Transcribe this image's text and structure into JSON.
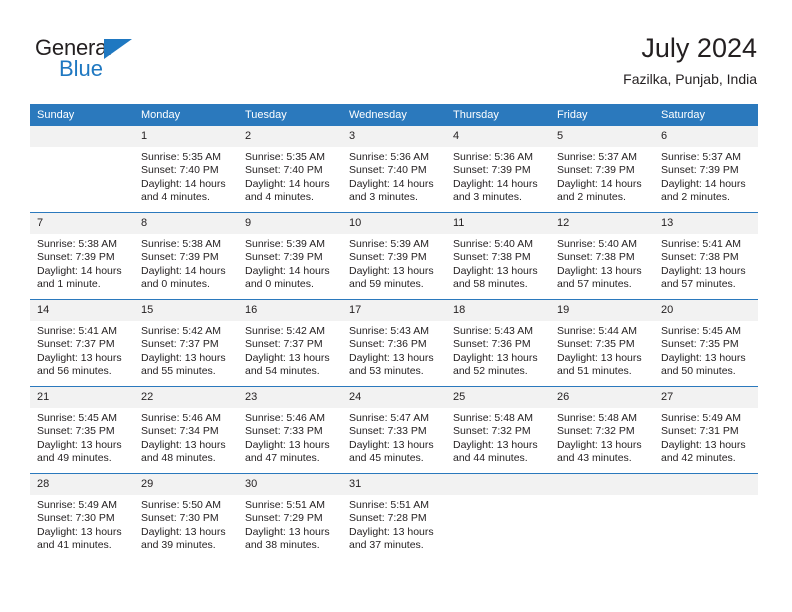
{
  "brand": {
    "name_top": "General",
    "name_bottom": "Blue"
  },
  "header": {
    "title": "July 2024",
    "subtitle": "Fazilka, Punjab, India"
  },
  "colors": {
    "header_blue": "#2b79bd",
    "logo_blue": "#1f78c1",
    "daynum_bg": "#f2f2f2",
    "text": "#231f20"
  },
  "weekdays": [
    "Sunday",
    "Monday",
    "Tuesday",
    "Wednesday",
    "Thursday",
    "Friday",
    "Saturday"
  ],
  "weeks": [
    [
      {
        "day": "",
        "sunrise": "",
        "sunset": "",
        "daylight": "",
        "daylight2": ""
      },
      {
        "day": "1",
        "sunrise": "Sunrise: 5:35 AM",
        "sunset": "Sunset: 7:40 PM",
        "daylight": "Daylight: 14 hours",
        "daylight2": "and 4 minutes."
      },
      {
        "day": "2",
        "sunrise": "Sunrise: 5:35 AM",
        "sunset": "Sunset: 7:40 PM",
        "daylight": "Daylight: 14 hours",
        "daylight2": "and 4 minutes."
      },
      {
        "day": "3",
        "sunrise": "Sunrise: 5:36 AM",
        "sunset": "Sunset: 7:40 PM",
        "daylight": "Daylight: 14 hours",
        "daylight2": "and 3 minutes."
      },
      {
        "day": "4",
        "sunrise": "Sunrise: 5:36 AM",
        "sunset": "Sunset: 7:39 PM",
        "daylight": "Daylight: 14 hours",
        "daylight2": "and 3 minutes."
      },
      {
        "day": "5",
        "sunrise": "Sunrise: 5:37 AM",
        "sunset": "Sunset: 7:39 PM",
        "daylight": "Daylight: 14 hours",
        "daylight2": "and 2 minutes."
      },
      {
        "day": "6",
        "sunrise": "Sunrise: 5:37 AM",
        "sunset": "Sunset: 7:39 PM",
        "daylight": "Daylight: 14 hours",
        "daylight2": "and 2 minutes."
      }
    ],
    [
      {
        "day": "7",
        "sunrise": "Sunrise: 5:38 AM",
        "sunset": "Sunset: 7:39 PM",
        "daylight": "Daylight: 14 hours",
        "daylight2": "and 1 minute."
      },
      {
        "day": "8",
        "sunrise": "Sunrise: 5:38 AM",
        "sunset": "Sunset: 7:39 PM",
        "daylight": "Daylight: 14 hours",
        "daylight2": "and 0 minutes."
      },
      {
        "day": "9",
        "sunrise": "Sunrise: 5:39 AM",
        "sunset": "Sunset: 7:39 PM",
        "daylight": "Daylight: 14 hours",
        "daylight2": "and 0 minutes."
      },
      {
        "day": "10",
        "sunrise": "Sunrise: 5:39 AM",
        "sunset": "Sunset: 7:39 PM",
        "daylight": "Daylight: 13 hours",
        "daylight2": "and 59 minutes."
      },
      {
        "day": "11",
        "sunrise": "Sunrise: 5:40 AM",
        "sunset": "Sunset: 7:38 PM",
        "daylight": "Daylight: 13 hours",
        "daylight2": "and 58 minutes."
      },
      {
        "day": "12",
        "sunrise": "Sunrise: 5:40 AM",
        "sunset": "Sunset: 7:38 PM",
        "daylight": "Daylight: 13 hours",
        "daylight2": "and 57 minutes."
      },
      {
        "day": "13",
        "sunrise": "Sunrise: 5:41 AM",
        "sunset": "Sunset: 7:38 PM",
        "daylight": "Daylight: 13 hours",
        "daylight2": "and 57 minutes."
      }
    ],
    [
      {
        "day": "14",
        "sunrise": "Sunrise: 5:41 AM",
        "sunset": "Sunset: 7:37 PM",
        "daylight": "Daylight: 13 hours",
        "daylight2": "and 56 minutes."
      },
      {
        "day": "15",
        "sunrise": "Sunrise: 5:42 AM",
        "sunset": "Sunset: 7:37 PM",
        "daylight": "Daylight: 13 hours",
        "daylight2": "and 55 minutes."
      },
      {
        "day": "16",
        "sunrise": "Sunrise: 5:42 AM",
        "sunset": "Sunset: 7:37 PM",
        "daylight": "Daylight: 13 hours",
        "daylight2": "and 54 minutes."
      },
      {
        "day": "17",
        "sunrise": "Sunrise: 5:43 AM",
        "sunset": "Sunset: 7:36 PM",
        "daylight": "Daylight: 13 hours",
        "daylight2": "and 53 minutes."
      },
      {
        "day": "18",
        "sunrise": "Sunrise: 5:43 AM",
        "sunset": "Sunset: 7:36 PM",
        "daylight": "Daylight: 13 hours",
        "daylight2": "and 52 minutes."
      },
      {
        "day": "19",
        "sunrise": "Sunrise: 5:44 AM",
        "sunset": "Sunset: 7:35 PM",
        "daylight": "Daylight: 13 hours",
        "daylight2": "and 51 minutes."
      },
      {
        "day": "20",
        "sunrise": "Sunrise: 5:45 AM",
        "sunset": "Sunset: 7:35 PM",
        "daylight": "Daylight: 13 hours",
        "daylight2": "and 50 minutes."
      }
    ],
    [
      {
        "day": "21",
        "sunrise": "Sunrise: 5:45 AM",
        "sunset": "Sunset: 7:35 PM",
        "daylight": "Daylight: 13 hours",
        "daylight2": "and 49 minutes."
      },
      {
        "day": "22",
        "sunrise": "Sunrise: 5:46 AM",
        "sunset": "Sunset: 7:34 PM",
        "daylight": "Daylight: 13 hours",
        "daylight2": "and 48 minutes."
      },
      {
        "day": "23",
        "sunrise": "Sunrise: 5:46 AM",
        "sunset": "Sunset: 7:33 PM",
        "daylight": "Daylight: 13 hours",
        "daylight2": "and 47 minutes."
      },
      {
        "day": "24",
        "sunrise": "Sunrise: 5:47 AM",
        "sunset": "Sunset: 7:33 PM",
        "daylight": "Daylight: 13 hours",
        "daylight2": "and 45 minutes."
      },
      {
        "day": "25",
        "sunrise": "Sunrise: 5:48 AM",
        "sunset": "Sunset: 7:32 PM",
        "daylight": "Daylight: 13 hours",
        "daylight2": "and 44 minutes."
      },
      {
        "day": "26",
        "sunrise": "Sunrise: 5:48 AM",
        "sunset": "Sunset: 7:32 PM",
        "daylight": "Daylight: 13 hours",
        "daylight2": "and 43 minutes."
      },
      {
        "day": "27",
        "sunrise": "Sunrise: 5:49 AM",
        "sunset": "Sunset: 7:31 PM",
        "daylight": "Daylight: 13 hours",
        "daylight2": "and 42 minutes."
      }
    ],
    [
      {
        "day": "28",
        "sunrise": "Sunrise: 5:49 AM",
        "sunset": "Sunset: 7:30 PM",
        "daylight": "Daylight: 13 hours",
        "daylight2": "and 41 minutes."
      },
      {
        "day": "29",
        "sunrise": "Sunrise: 5:50 AM",
        "sunset": "Sunset: 7:30 PM",
        "daylight": "Daylight: 13 hours",
        "daylight2": "and 39 minutes."
      },
      {
        "day": "30",
        "sunrise": "Sunrise: 5:51 AM",
        "sunset": "Sunset: 7:29 PM",
        "daylight": "Daylight: 13 hours",
        "daylight2": "and 38 minutes."
      },
      {
        "day": "31",
        "sunrise": "Sunrise: 5:51 AM",
        "sunset": "Sunset: 7:28 PM",
        "daylight": "Daylight: 13 hours",
        "daylight2": "and 37 minutes."
      },
      {
        "day": "",
        "sunrise": "",
        "sunset": "",
        "daylight": "",
        "daylight2": ""
      },
      {
        "day": "",
        "sunrise": "",
        "sunset": "",
        "daylight": "",
        "daylight2": ""
      },
      {
        "day": "",
        "sunrise": "",
        "sunset": "",
        "daylight": "",
        "daylight2": ""
      }
    ]
  ]
}
